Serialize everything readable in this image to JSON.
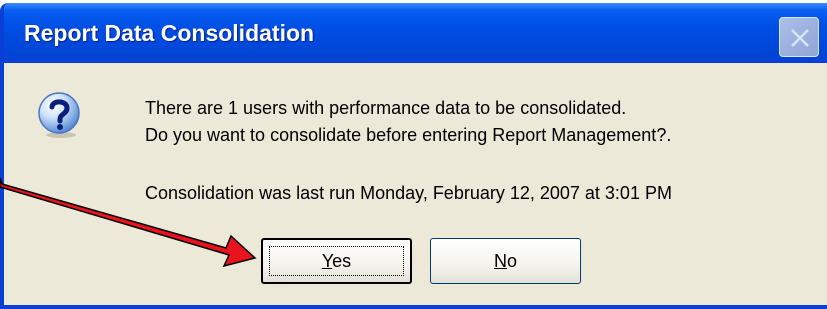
{
  "window": {
    "title": "Report Data Consolidation",
    "close_icon": "close-icon"
  },
  "message": {
    "icon": "question-icon",
    "line1": "There are 1 users with performance data to be consolidated.",
    "line2": "Do you want to consolidate before entering Report Management?.",
    "line3": "Consolidation was last run Monday, February 12, 2007 at 3:01 PM"
  },
  "buttons": {
    "yes": {
      "accel": "Y",
      "rest": "es"
    },
    "no": {
      "accel": "N",
      "rest": "o"
    }
  },
  "annotation": {
    "arrow_color": "#e8131b"
  }
}
